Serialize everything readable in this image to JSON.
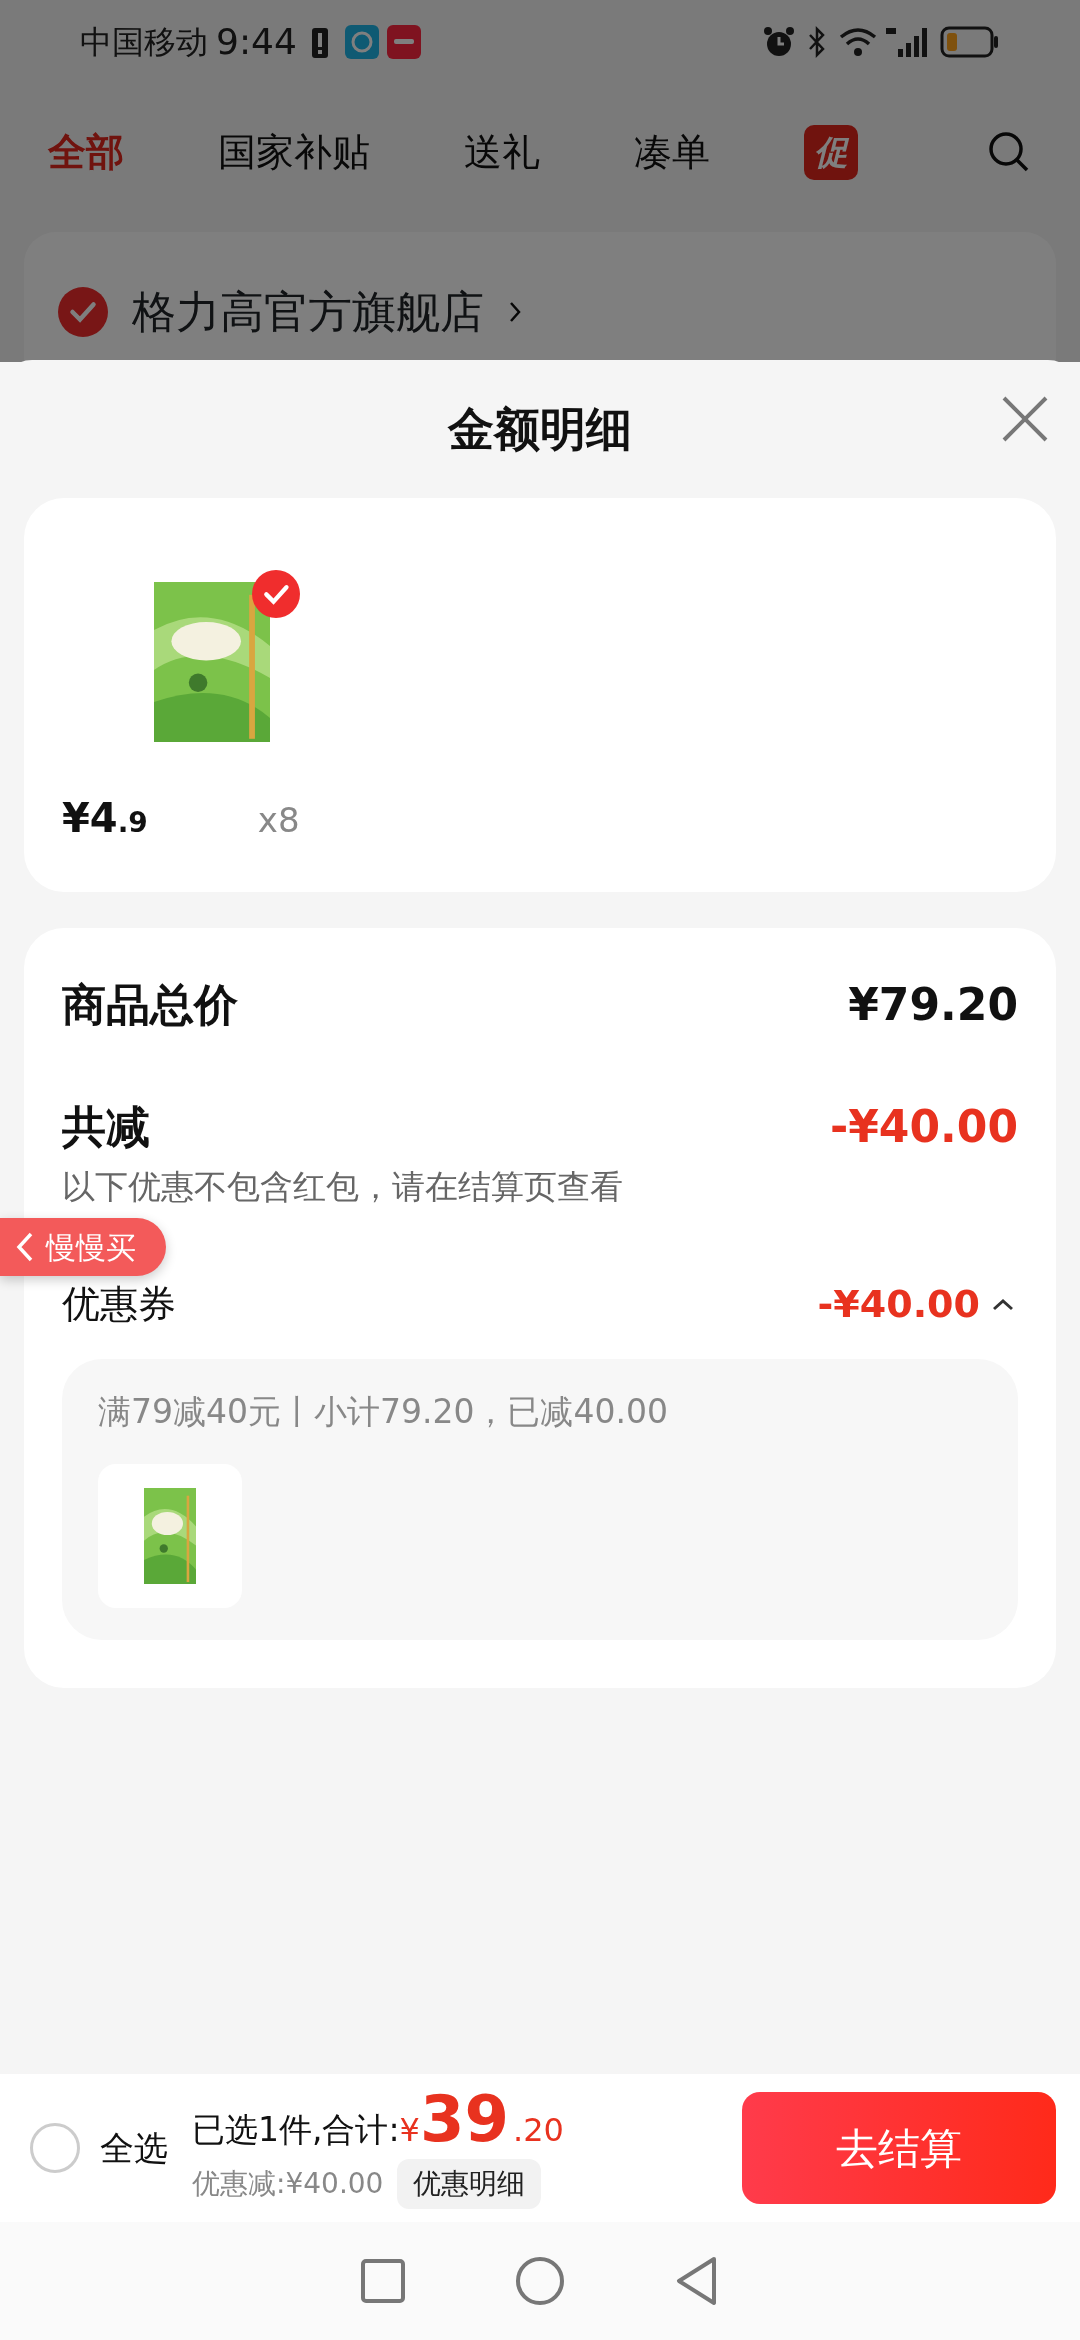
{
  "status_bar": {
    "carrier": "中国移动",
    "time": "9:44"
  },
  "tabs": [
    {
      "label": "全部",
      "selected": true
    },
    {
      "label": "国家补贴",
      "selected": false
    },
    {
      "label": "送礼",
      "selected": false
    },
    {
      "label": "凑单",
      "selected": false
    }
  ],
  "promo_badge": "促",
  "store": {
    "name": "格力高官方旗舰店",
    "checked": true
  },
  "sheet": {
    "title": "金额明细",
    "items": [
      {
        "kind": "picture",
        "price": "¥4",
        "price_decimal": ".9",
        "quantity": "x8",
        "checked": true
      }
    ],
    "summary": {
      "total_label": "商品总价",
      "total_value": "¥79.20",
      "reduction_label": "共减",
      "reduction_value": "-¥40.00",
      "note": "以下优惠不包含红包，请在结算页查看",
      "coupon_label": "优惠券",
      "coupon_value": "-¥40.00",
      "expanded": true,
      "coupon_detail": {
        "text": "满79减40元丨小计79.20，已减40.00"
      }
    }
  },
  "floating_button": "慢慢买",
  "bottom_bar": {
    "select_all": {
      "label": "全选",
      "checked": false
    },
    "selected_text": "已选1件,合计:",
    "currency": "¥",
    "amount": "39",
    "amount_decimal": ".20",
    "discount": "优惠减:¥40.00",
    "detail_button": "优惠明细",
    "checkout": "去结算"
  }
}
